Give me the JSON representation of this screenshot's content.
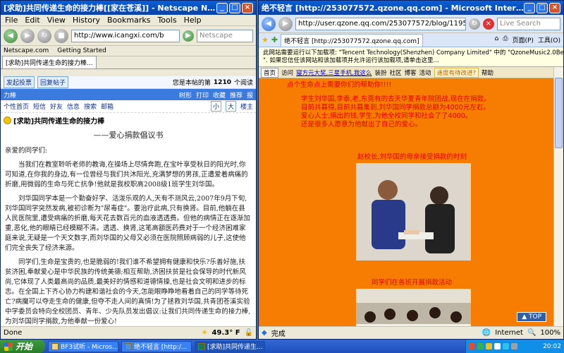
{
  "netscape": {
    "title": "[求助]共同传递生命的接力棒[[家在苍溪]] - Netscape Navigator",
    "menu": [
      "File",
      "Edit",
      "View",
      "History",
      "Bookmarks",
      "Tools",
      "Help"
    ],
    "address": "http://www.icangxi.com/b",
    "search_placeholder": "Netscape",
    "bookmarks": [
      "Netscape.com",
      "Getting Started"
    ],
    "tab": "[求助]共同传递生命的接力棒...",
    "forum": {
      "btn_post": "发起投票",
      "btn_reply": "回复帖子",
      "views_text": "您是本帖的第",
      "views": "1210",
      "views_suffix": "个阅读",
      "bluebar_left": "力棒",
      "bluebar_links": [
        "树形",
        "打印",
        "收藏",
        "推荐",
        "报"
      ],
      "nav_links": [
        "个性首页",
        "短信",
        "好友",
        "信息",
        "搜索",
        "邮箱"
      ],
      "font_small": "小",
      "font_big": "大",
      "floor": "楼主",
      "post_title": "[求助]共同传递生命的接力棒",
      "heading": "——爱心捐款倡议书",
      "greeting": "亲爱的同学们:",
      "p1": "当我们在教室聆听老师的教诲,在操场上尽情奔跑,在宝叶享受秋日的阳光时,你可知道,在你我的身边,有一位曾经与我们共沐阳光,充满梦想的男孩,正遭爱着病痛的折磨,用微弱的生命与死亡抗争!他就是我校职高2008级1班学生刘华国。",
      "p2": "刘华国同学本是一个勤奋好学、活泼乐观的人,天有不测风云,2007年9月下旬,刘华国同学突然发病,被初诊断为\"尿毒症\"。要治疗此病,只有换肾。目前,他躺在县人民医院里,遭受病痛的折磨,每天花去数百元的血液透透费。但他的病情正在逐渐加重,恶化,他的眼睛已经模糊不清。透透、换肾,这笔高额医药费对于一个经济困难家庭来说,无疑是一个天文数字,而刘华国的父母又必须在医院照顾病弱的儿子,这使他们完全丧失了经济来源。",
      "p3": "同学们,生命是宝贵的,也是脆弱的!我们谁不希望拥有健康和快乐?乐善好施,扶贫济困,奉献爱心是中华民族的传统美德;相互帮助,济困扶贫是社会保导的时代新风尚,它体现了人类最高尚的品质,最美好的情感和道德情操,也是社会文明和进步的标志。在全国上下齐心协力构建和谐社会的今天,怎能眼睁睁地看着自己的同学等待死亡?病魔可以夺走生命的健康,但夺不走人间的真情!为了拯救刘华国,共青团苍溪实验中学委员会特向全校团员、青年、少先队员发出倡议:让我们共同传递生命的接力棒,为刘华国同学捐款,为他奉献一份爱心!"
    },
    "status": {
      "left": "Done",
      "temp": "49.3° F"
    }
  },
  "ie": {
    "title": "绝不轻言 [http://253077572.qzone.qq.com] - Microsoft Internet Explorer",
    "address": "http://user.qzone.qq.com/253077572/blog/1195",
    "search_placeholder": "Live Search",
    "tab": "绝不轻言 [http://253077572.qzone.qq.com]",
    "tools": [
      "页面(P)",
      "工具(O)"
    ],
    "infobar_1": "此网站需要运行以下加载项: \"Tencent Technology(Shenzhen) Company Limited\" 中的 \"QzoneMusic2.0Beta09Build10",
    "infobar_2": "\". 如果您信任该网站和该加载项并允许运行该加载项,请单击这里...",
    "qznav": {
      "home": "首页",
      "visit": "访问",
      "link1": "寝方元大奖,三星手机,我这么",
      "dressup": "装扮",
      "area": "社区",
      "blog": "博客",
      "activity": "活动",
      "tip": "速度有待改进?",
      "help": "帮助"
    },
    "line0": "点个生命点上需要你们的帮助你!!!!",
    "lines": [
      "学生刘华国,李泰,老,东莞有的去天华夏青年院团战,现在在捐款。",
      "目前共募得,目前共募集到,刘华国同学捐款总额为4000元左右。",
      "爱心人士,捐出的钱,学生,为他全校同学和社会了了4000。",
      "还是很多人愿意为他献出了自己的爱心。"
    ],
    "caption1": "赵校长,刘华国的母亲接受捐款的时刻",
    "caption2": "同学们在各班开展捐款活动",
    "top_btn": "▲ TOP",
    "status": {
      "left": "完成",
      "zone": "Internet",
      "zoom": "100%"
    }
  },
  "taskbar": {
    "start": "开始",
    "tasks": [
      "BF3试听 - Micros...",
      "绝不轻言 [http:/...",
      "[求助]共同传递生..."
    ],
    "clock": "20:02"
  }
}
